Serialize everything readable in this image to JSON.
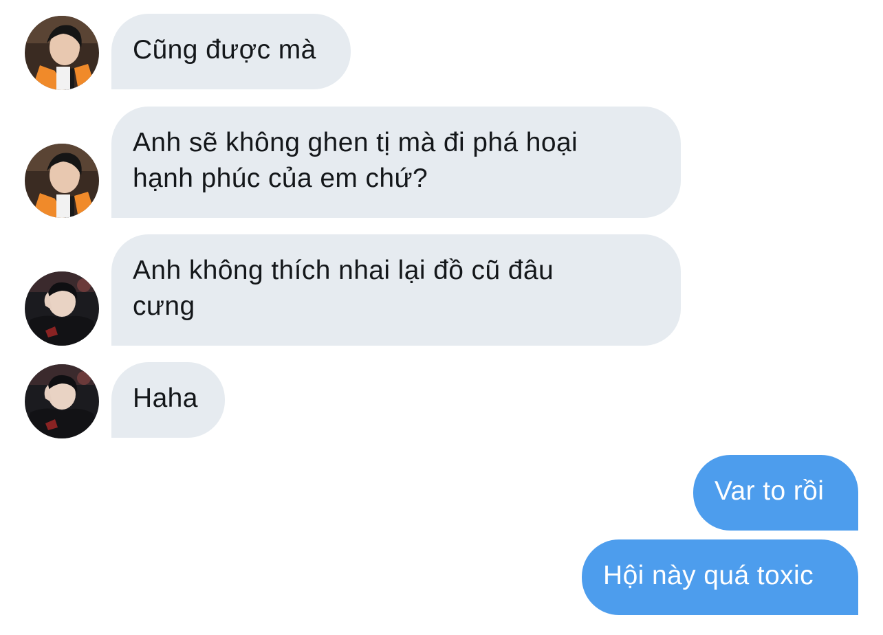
{
  "conversation": {
    "messages": [
      {
        "direction": "incoming",
        "sender_avatar": "avatar-orange-scarf",
        "text": "Cũng được mà"
      },
      {
        "direction": "incoming",
        "sender_avatar": "avatar-orange-scarf",
        "text": "Anh sẽ không ghen tị mà đi phá hoại\nhạnh phúc của em chứ?"
      },
      {
        "direction": "incoming",
        "sender_avatar": "avatar-black-jacket",
        "text": "Anh không thích nhai lại đồ cũ đâu\ncưng"
      },
      {
        "direction": "incoming",
        "sender_avatar": "avatar-black-jacket",
        "text": "Haha"
      },
      {
        "direction": "outgoing",
        "text": "Var to rồi"
      },
      {
        "direction": "outgoing",
        "text": "Hội này quá toxic"
      }
    ]
  },
  "colors": {
    "incoming_bubble": "#e6ebf0",
    "incoming_text": "#14171a",
    "outgoing_bubble": "#4d9ded",
    "outgoing_text": "#ffffff",
    "background": "#ffffff"
  }
}
